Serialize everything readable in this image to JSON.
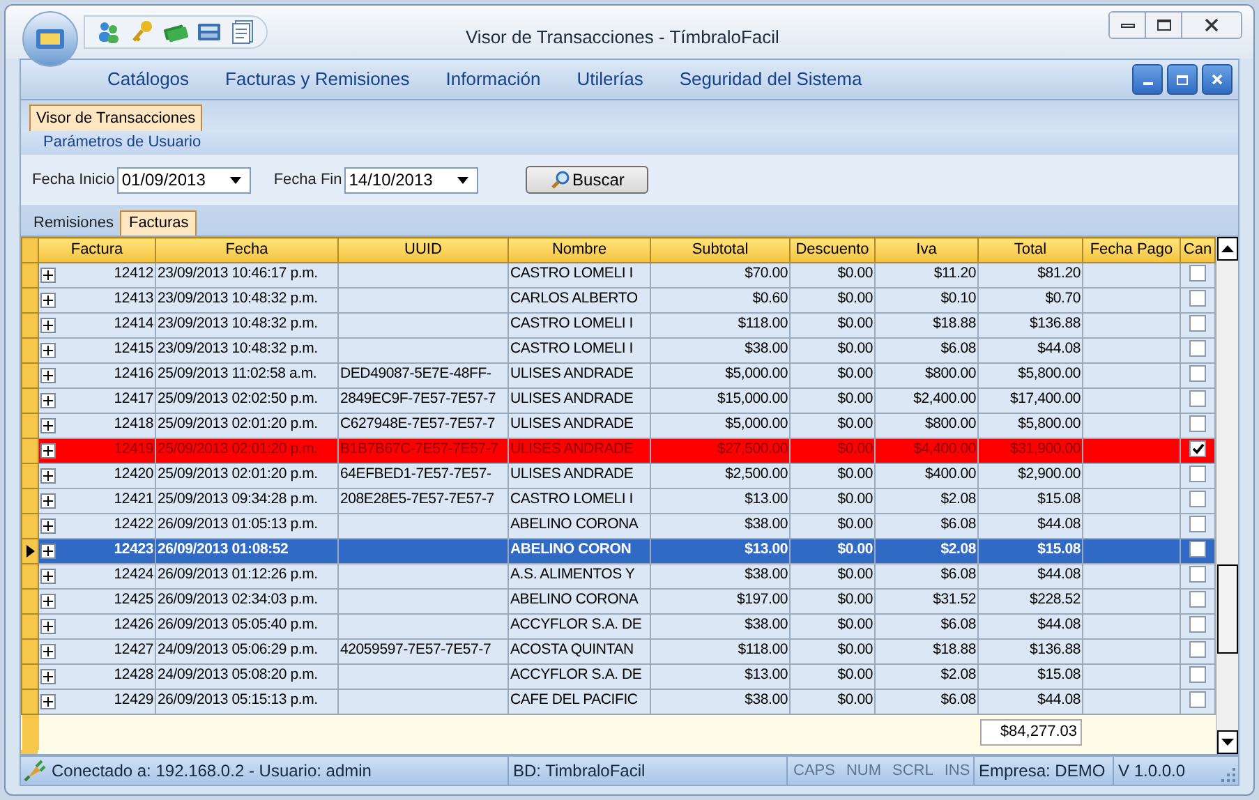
{
  "window": {
    "title": "Visor de Transacciones - TímbraloFacil"
  },
  "menu": [
    "Catálogos",
    "Facturas y Remisiones",
    "Información",
    "Utilerías",
    "Seguridad del Sistema"
  ],
  "document_tabs": [
    {
      "label": "Visor de Transacciones",
      "selected": true
    }
  ],
  "parameters": {
    "title": "Parámetros de Usuario",
    "fecha_inicio": {
      "label": "Fecha Inicio",
      "value": "01/09/2013"
    },
    "fecha_fin": {
      "label": "Fecha Fin",
      "value": "14/10/2013"
    },
    "search_button": "Buscar"
  },
  "tabs": [
    {
      "label": "Remisiones",
      "selected": false
    },
    {
      "label": "Facturas",
      "selected": true
    }
  ],
  "table": {
    "columns": [
      "Factura",
      "Fecha",
      "UUID",
      "Nombre",
      "Subtotal",
      "Descuento",
      "Iva",
      "Total",
      "Fecha Pago",
      "Can"
    ],
    "rows": [
      {
        "factura": "12412",
        "fecha": "23/09/2013 10:46:17 p.m.",
        "uuid": "",
        "nombre": "CASTRO LOMELI I",
        "subtotal": "$70.00",
        "descuento": "$0.00",
        "iva": "$11.20",
        "total": "$81.20",
        "cancelled": false,
        "selected": false
      },
      {
        "factura": "12413",
        "fecha": "23/09/2013 10:48:32 p.m.",
        "uuid": "",
        "nombre": "CARLOS ALBERTO",
        "subtotal": "$0.60",
        "descuento": "$0.00",
        "iva": "$0.10",
        "total": "$0.70",
        "cancelled": false,
        "selected": false
      },
      {
        "factura": "12414",
        "fecha": "23/09/2013 10:48:32 p.m.",
        "uuid": "",
        "nombre": "CASTRO LOMELI I",
        "subtotal": "$118.00",
        "descuento": "$0.00",
        "iva": "$18.88",
        "total": "$136.88",
        "cancelled": false,
        "selected": false
      },
      {
        "factura": "12415",
        "fecha": "23/09/2013 10:48:32 p.m.",
        "uuid": "",
        "nombre": "CASTRO LOMELI I",
        "subtotal": "$38.00",
        "descuento": "$0.00",
        "iva": "$6.08",
        "total": "$44.08",
        "cancelled": false,
        "selected": false
      },
      {
        "factura": "12416",
        "fecha": "25/09/2013 11:02:58 a.m.",
        "uuid": "DED49087-5E7E-48FF-",
        "nombre": "ULISES ANDRADE",
        "subtotal": "$5,000.00",
        "descuento": "$0.00",
        "iva": "$800.00",
        "total": "$5,800.00",
        "cancelled": false,
        "selected": false
      },
      {
        "factura": "12417",
        "fecha": "25/09/2013 02:02:50 p.m.",
        "uuid": "2849EC9F-7E57-7E57-7",
        "nombre": "ULISES ANDRADE",
        "subtotal": "$15,000.00",
        "descuento": "$0.00",
        "iva": "$2,400.00",
        "total": "$17,400.00",
        "cancelled": false,
        "selected": false
      },
      {
        "factura": "12418",
        "fecha": "25/09/2013 02:01:20 p.m.",
        "uuid": "C627948E-7E57-7E57-7",
        "nombre": "ULISES ANDRADE",
        "subtotal": "$5,000.00",
        "descuento": "$0.00",
        "iva": "$800.00",
        "total": "$5,800.00",
        "cancelled": false,
        "selected": false
      },
      {
        "factura": "12419",
        "fecha": "25/09/2013 02:01:20 p.m.",
        "uuid": "B1B7B67C-7E57-7E57-7",
        "nombre": "ULISES ANDRADE",
        "subtotal": "$27,500.00",
        "descuento": "$0.00",
        "iva": "$4,400.00",
        "total": "$31,900.00",
        "cancelled": true,
        "selected": false
      },
      {
        "factura": "12420",
        "fecha": "25/09/2013 02:01:20 p.m.",
        "uuid": "64EFBED1-7E57-7E57-",
        "nombre": "ULISES ANDRADE",
        "subtotal": "$2,500.00",
        "descuento": "$0.00",
        "iva": "$400.00",
        "total": "$2,900.00",
        "cancelled": false,
        "selected": false
      },
      {
        "factura": "12421",
        "fecha": "25/09/2013 09:34:28 p.m.",
        "uuid": "208E28E5-7E57-7E57-7",
        "nombre": "CASTRO LOMELI I",
        "subtotal": "$13.00",
        "descuento": "$0.00",
        "iva": "$2.08",
        "total": "$15.08",
        "cancelled": false,
        "selected": false
      },
      {
        "factura": "12422",
        "fecha": "26/09/2013 01:05:13 p.m.",
        "uuid": "",
        "nombre": "ABELINO CORONA",
        "subtotal": "$38.00",
        "descuento": "$0.00",
        "iva": "$6.08",
        "total": "$44.08",
        "cancelled": false,
        "selected": false
      },
      {
        "factura": "12423",
        "fecha": "26/09/2013 01:08:52",
        "uuid": "",
        "nombre": "ABELINO CORON",
        "subtotal": "$13.00",
        "descuento": "$0.00",
        "iva": "$2.08",
        "total": "$15.08",
        "cancelled": false,
        "selected": true
      },
      {
        "factura": "12424",
        "fecha": "26/09/2013 01:12:26 p.m.",
        "uuid": "",
        "nombre": "A.S. ALIMENTOS Y",
        "subtotal": "$38.00",
        "descuento": "$0.00",
        "iva": "$6.08",
        "total": "$44.08",
        "cancelled": false,
        "selected": false
      },
      {
        "factura": "12425",
        "fecha": "26/09/2013 02:34:03 p.m.",
        "uuid": "",
        "nombre": "ABELINO CORONA",
        "subtotal": "$197.00",
        "descuento": "$0.00",
        "iva": "$31.52",
        "total": "$228.52",
        "cancelled": false,
        "selected": false
      },
      {
        "factura": "12426",
        "fecha": "26/09/2013 05:05:40 p.m.",
        "uuid": "",
        "nombre": "ACCYFLOR S.A. DE",
        "subtotal": "$38.00",
        "descuento": "$0.00",
        "iva": "$6.08",
        "total": "$44.08",
        "cancelled": false,
        "selected": false
      },
      {
        "factura": "12427",
        "fecha": "24/09/2013 05:06:29 p.m.",
        "uuid": "42059597-7E57-7E57-7",
        "nombre": "ACOSTA QUINTAN",
        "subtotal": "$118.00",
        "descuento": "$0.00",
        "iva": "$18.88",
        "total": "$136.88",
        "cancelled": false,
        "selected": false
      },
      {
        "factura": "12428",
        "fecha": "24/09/2013 05:08:20 p.m.",
        "uuid": "",
        "nombre": "ACCYFLOR S.A. DE",
        "subtotal": "$13.00",
        "descuento": "$0.00",
        "iva": "$2.08",
        "total": "$15.08",
        "cancelled": false,
        "selected": false
      },
      {
        "factura": "12429",
        "fecha": "26/09/2013 05:15:13 p.m.",
        "uuid": "",
        "nombre": "CAFE DEL PACIFIC",
        "subtotal": "$38.00",
        "descuento": "$0.00",
        "iva": "$6.08",
        "total": "$44.08",
        "cancelled": false,
        "selected": false
      }
    ],
    "total_sum": "$84,277.03"
  },
  "status_bar": {
    "connection": "Conectado a: 192.168.0.2 - Usuario: admin",
    "database": "BD: TimbraloFacil",
    "keys": [
      {
        "label": "CAPS",
        "disabled": true
      },
      {
        "label": "NUM",
        "disabled": true
      },
      {
        "label": "SCRL",
        "disabled": true
      },
      {
        "label": "INS",
        "disabled": true
      }
    ],
    "company": "Empresa: DEMO",
    "version": "V 1.0.0.0"
  }
}
